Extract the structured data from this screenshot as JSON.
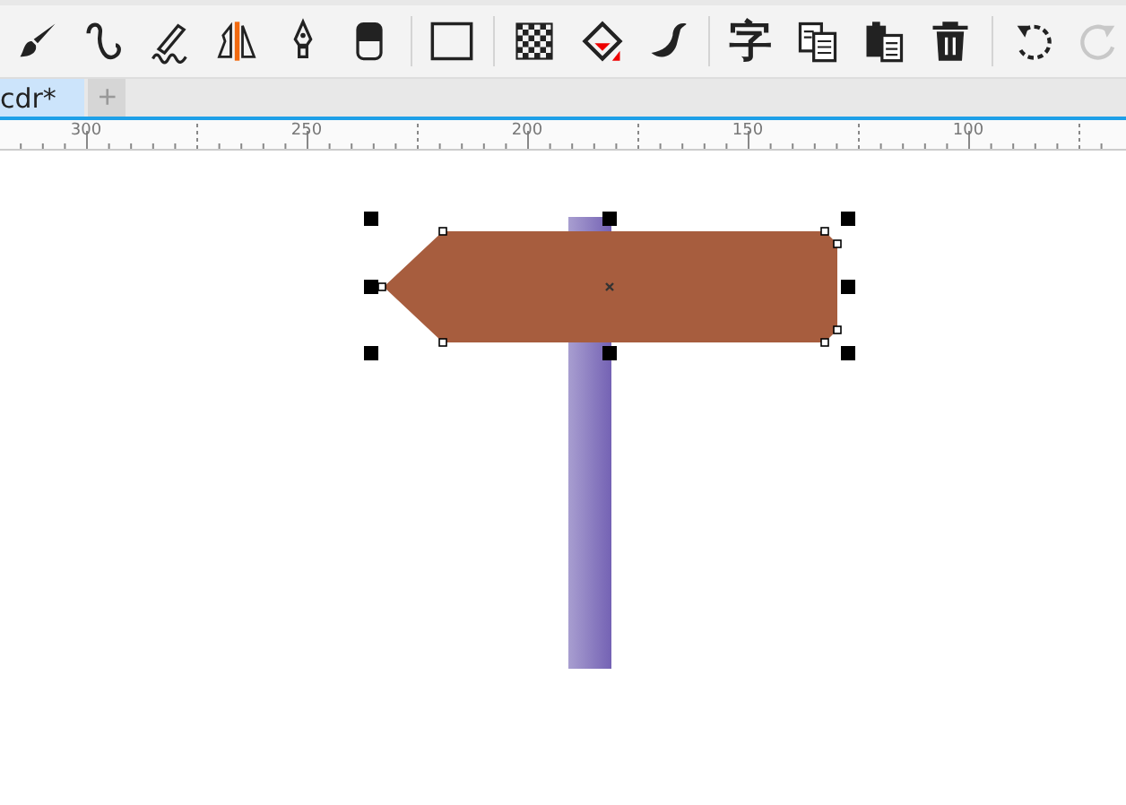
{
  "toolbar": [
    {
      "kind": "brush",
      "disabled": false
    },
    {
      "kind": "curve",
      "disabled": false
    },
    {
      "kind": "artistic",
      "disabled": false
    },
    {
      "kind": "mirror",
      "disabled": false
    },
    {
      "kind": "pen",
      "disabled": false
    },
    {
      "kind": "eraser",
      "disabled": false
    },
    {
      "kind": "separator"
    },
    {
      "kind": "rectangle",
      "disabled": false
    },
    {
      "kind": "separator"
    },
    {
      "kind": "transparency",
      "disabled": false
    },
    {
      "kind": "fill",
      "disabled": false
    },
    {
      "kind": "dropper",
      "disabled": false
    },
    {
      "kind": "separator"
    },
    {
      "kind": "text",
      "glyph": "字",
      "disabled": false
    },
    {
      "kind": "copy",
      "disabled": false
    },
    {
      "kind": "paste",
      "disabled": false
    },
    {
      "kind": "delete",
      "disabled": false
    },
    {
      "kind": "separator"
    },
    {
      "kind": "undo",
      "disabled": false
    },
    {
      "kind": "redo",
      "disabled": true
    }
  ],
  "tabs": [
    {
      "label": "cdr*",
      "selected": true
    }
  ],
  "new_tab": "+",
  "ruler": {
    "labels": [
      "300",
      "250",
      "200",
      "150",
      "100"
    ]
  }
}
